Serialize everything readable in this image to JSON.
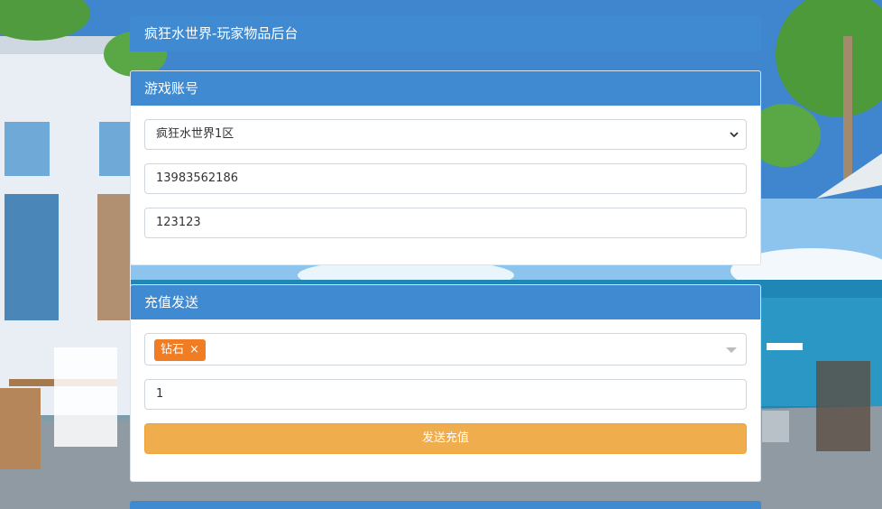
{
  "header": {
    "title": "疯狂水世界-玩家物品后台"
  },
  "account_panel": {
    "title": "游戏账号",
    "server_select": {
      "value": "疯狂水世界1区"
    },
    "account_input": {
      "value": "13983562186"
    },
    "password_input": {
      "value": "123123"
    }
  },
  "recharge_panel": {
    "title": "充值发送",
    "item_select": {
      "selected_tag": "钻石",
      "remove_glyph": "×"
    },
    "quantity_input": {
      "value": "1"
    },
    "send_button": {
      "label": "发送充值"
    }
  },
  "colors": {
    "header_blue": "#3f8ad0",
    "button_orange": "#f0ad4e",
    "tag_orange": "#f07d23"
  }
}
